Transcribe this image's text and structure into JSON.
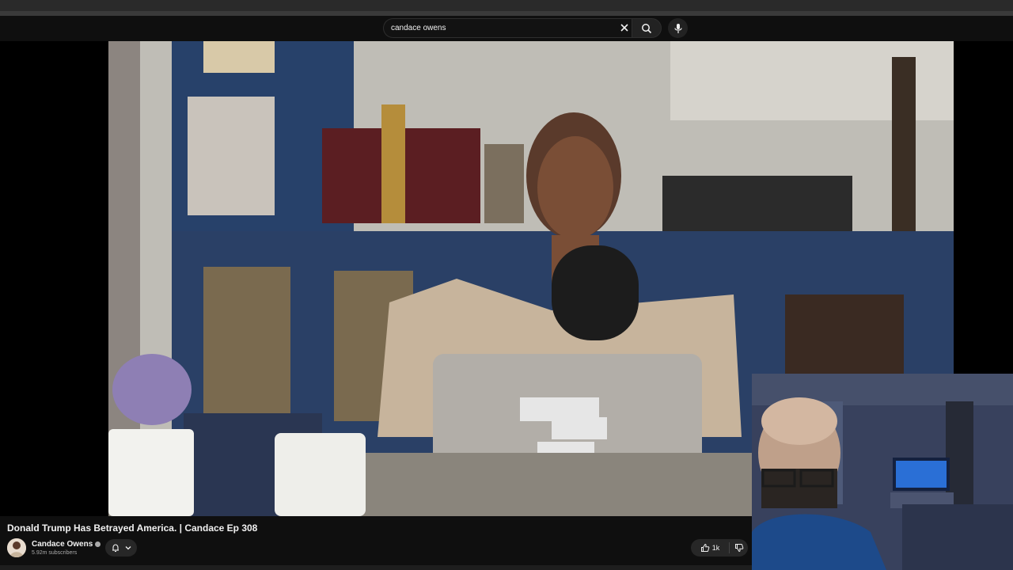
{
  "search": {
    "value": "candace owens",
    "placeholder": "Search"
  },
  "video": {
    "title": "Donald Trump Has Betrayed America. | Candace Ep 308",
    "channel": "Candace Owens",
    "subscribers": "5.92m subscribers",
    "likes": "1k"
  },
  "icons": {
    "clear": "close-icon",
    "search": "search-icon",
    "mic": "mic-icon",
    "bell": "bell-icon",
    "chevron": "chevron-down-icon",
    "like": "thumbs-up-icon",
    "dislike": "thumbs-down-icon",
    "verified": "verified-icon"
  },
  "colors": {
    "background": "#0f0f0f",
    "text": "#f1f1f1",
    "secondary_text": "#aaaaaa"
  }
}
